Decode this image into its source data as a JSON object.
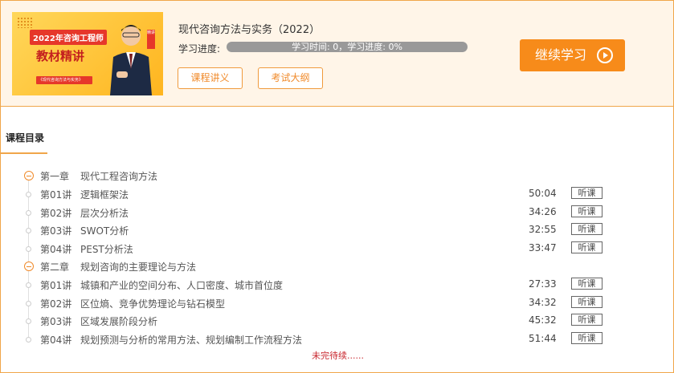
{
  "course": {
    "cover": {
      "tag": "2022年咨询工程师",
      "headline": "教材精讲",
      "strip": "《现代咨询方法与实务》",
      "badge": "精讲"
    },
    "title": "现代咨询方法与实务（2022）",
    "progress_label": "学习进度:",
    "progress_text": "学习时间: 0，学习进度: 0%",
    "progress_fraction": 0,
    "lecture_notes_label": "课程讲义",
    "exam_outline_label": "考试大纲",
    "continue_label": "继续学习"
  },
  "catalog": {
    "title": "课程目录",
    "listen_label": "听课",
    "chapters": [
      {
        "num": "第一章",
        "name": "现代工程咨询方法",
        "lessons": [
          {
            "num": "第01讲",
            "name": "逻辑框架法",
            "duration": "50:04"
          },
          {
            "num": "第02讲",
            "name": "层次分析法",
            "duration": "34:26"
          },
          {
            "num": "第03讲",
            "name": "SWOT分析",
            "duration": "32:55"
          },
          {
            "num": "第04讲",
            "name": "PEST分析法",
            "duration": "33:47"
          }
        ]
      },
      {
        "num": "第二章",
        "name": "规划咨询的主要理论与方法",
        "lessons": [
          {
            "num": "第01讲",
            "name": "城镇和产业的空间分布、人口密度、城市首位度",
            "duration": "27:33"
          },
          {
            "num": "第02讲",
            "name": "区位熵、竞争优势理论与钻石模型",
            "duration": "34:32"
          },
          {
            "num": "第03讲",
            "name": "区域发展阶段分析",
            "duration": "45:32"
          },
          {
            "num": "第04讲",
            "name": "规划预测与分析的常用方法、规划编制工作流程方法",
            "duration": "51:44"
          }
        ]
      }
    ],
    "pending_text": "未完待续......"
  }
}
